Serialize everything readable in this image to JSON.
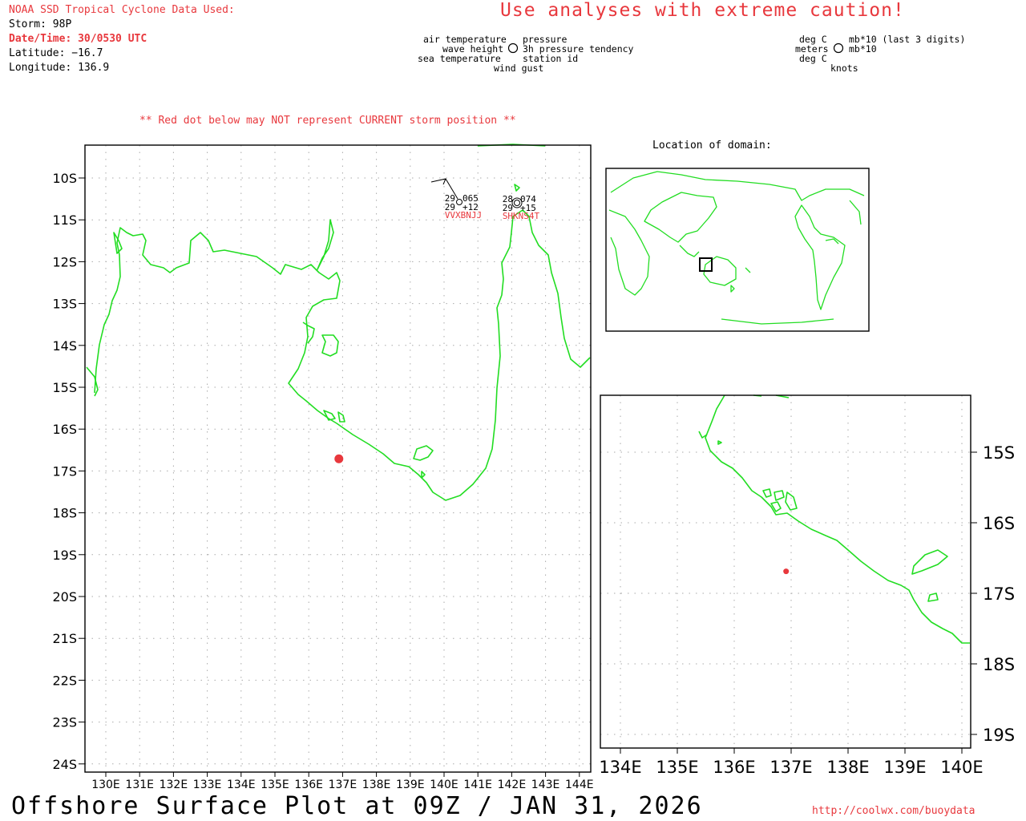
{
  "header": {
    "source_title": "NOAA SSD Tropical Cyclone Data Used:",
    "storm": "Storm: 98P",
    "datetime": "Date/Time: 30/0530 UTC",
    "latitude": "Latitude: −16.7",
    "longitude": "Longitude: 136.9",
    "caution": "Use analyses with extreme caution!"
  },
  "legend": {
    "air_temperature": "air temperature",
    "wave_height": "wave height",
    "sea_temperature": "sea temperature",
    "wind_gust": "wind gust",
    "pressure": "pressure",
    "pressure_tendency": "3h pressure tendency",
    "station_id": "station id",
    "units_left_1": "deg C",
    "units_left_2": "meters",
    "units_left_3": "deg C",
    "units_right_1": "mb*10 (last 3 digits)",
    "units_right_2": "mb*10",
    "units_right_3": "knots"
  },
  "note": "** Red dot below may NOT represent CURRENT storm position **",
  "location_title": "Location of domain:",
  "main_map": {
    "lon_range": [
      129.5,
      144.5
    ],
    "lat_range": [
      -24.3,
      -9.2
    ],
    "lat_labels": [
      "10S",
      "11S",
      "12S",
      "13S",
      "14S",
      "15S",
      "16S",
      "17S",
      "18S",
      "19S",
      "20S",
      "21S",
      "22S",
      "23S",
      "24S"
    ],
    "lon_labels": [
      "130E",
      "131E",
      "132E",
      "133E",
      "134E",
      "135E",
      "136E",
      "137E",
      "138E",
      "139E",
      "140E",
      "141E",
      "142E",
      "143E",
      "144E"
    ],
    "storm_dot": {
      "lon": 136.9,
      "lat": -16.7
    },
    "stations": [
      {
        "id": "VVXBNJJ",
        "air_temp": "29",
        "pressure": "065",
        "sea_temp": "29",
        "tendency": "+12"
      },
      {
        "id": "SHKNS4T",
        "air_temp": "28",
        "pressure": "074",
        "sea_temp": "29",
        "tendency": "+15"
      }
    ]
  },
  "zoom_map": {
    "lon_range": [
      133.6,
      140.2
    ],
    "lat_range": [
      -19.2,
      -14.4
    ],
    "lat_labels": [
      "15S",
      "16S",
      "17S",
      "18S",
      "19S"
    ],
    "lon_labels": [
      "134E",
      "135E",
      "136E",
      "137E",
      "138E",
      "139E",
      "140E"
    ],
    "storm_dot": {
      "lon": 136.9,
      "lat": -16.7
    }
  },
  "footer": {
    "title": "Offshore Surface Plot at 09Z / JAN 31, 2026",
    "url": "http://coolwx.com/buoydata"
  },
  "colors": {
    "coast": "#22dd22",
    "alert": "#e8383d",
    "grid": "#aaaaaa"
  }
}
